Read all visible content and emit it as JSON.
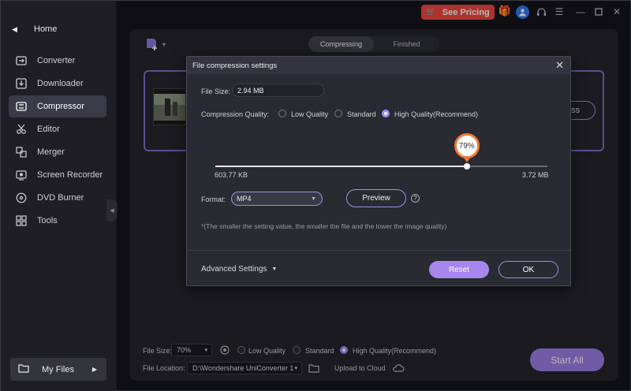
{
  "sidebar": {
    "home_label": "Home",
    "items": [
      {
        "label": "Converter",
        "icon": "converter-icon"
      },
      {
        "label": "Downloader",
        "icon": "downloader-icon"
      },
      {
        "label": "Compressor",
        "icon": "compressor-icon",
        "active": true
      },
      {
        "label": "Editor",
        "icon": "editor-icon"
      },
      {
        "label": "Merger",
        "icon": "merger-icon"
      },
      {
        "label": "Screen Recorder",
        "icon": "screen-recorder-icon"
      },
      {
        "label": "DVD Burner",
        "icon": "dvd-burner-icon"
      },
      {
        "label": "Tools",
        "icon": "tools-icon"
      }
    ],
    "my_files_label": "My Files"
  },
  "topbar": {
    "pricing_label": "See Pricing",
    "pricing_color": "#f0483e"
  },
  "main": {
    "tabs": [
      {
        "label": "Compressing",
        "active": true
      },
      {
        "label": "Finished",
        "active": false
      }
    ],
    "behind_button_fragment": "ess"
  },
  "bottom": {
    "file_size_label": "File Size:",
    "file_size_value": "70%",
    "quality_options": [
      "Low Quality",
      "Standard",
      "High Quality(Recommend)"
    ],
    "quality_selected": "High Quality(Recommend)",
    "file_location_label": "File Location:",
    "file_location_value": "D:\\Wondershare UniConverter 1",
    "upload_label": "Upload to Cloud",
    "start_all_label": "Start All"
  },
  "dialog": {
    "title": "File compression settings",
    "file_size_label": "File Size:",
    "file_size_value": "2.94 MB",
    "quality_label": "Compression Quality:",
    "quality_options": [
      "Low Quality",
      "Standard",
      "High Quality(Recommend)"
    ],
    "quality_selected": "High Quality(Recommend)",
    "slider": {
      "percent_label": "79%",
      "value_fraction": 0.757,
      "min_label": "603.77 KB",
      "max_label": "3.72 MB"
    },
    "format_label": "Format:",
    "format_value": "MP4",
    "preview_label": "Preview",
    "note": "*(The smaller the setting value, the smaller the file and the lower the image quality)",
    "advanced_label": "Advanced Settings",
    "reset_label": "Reset",
    "ok_label": "OK",
    "accent_color": "#9b8cff"
  }
}
